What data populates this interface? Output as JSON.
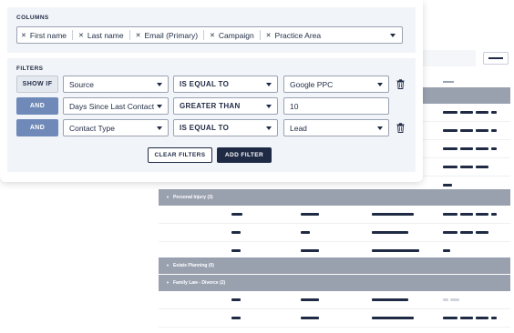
{
  "columns": {
    "title": "COLUMNS",
    "chips": [
      "First name",
      "Last name",
      "Email (Primary)",
      "Campaign",
      "Practice Area"
    ]
  },
  "filters": {
    "title": "FILTERS",
    "rows": [
      {
        "op": "SHOW IF",
        "field": "Source",
        "operator": "IS EQUAL TO",
        "value": "Google PPC",
        "value_type": "select"
      },
      {
        "op": "AND",
        "field": "Days Since Last Contact",
        "operator": "GREATER THAN",
        "value": "10",
        "value_type": "text"
      },
      {
        "op": "AND",
        "field": "Contact Type",
        "operator": "IS EQUAL TO",
        "value": "Lead",
        "value_type": "select"
      }
    ],
    "clear_label": "CLEAR FILTERS",
    "add_label": "ADD FILTER"
  },
  "table": {
    "groups": [
      "Personal Injury (3)",
      "Estate Planning (0)",
      "Family Law - Divorce (2)"
    ]
  },
  "icons": {
    "remove": "close-icon",
    "dropdown": "chevron-down-icon",
    "delete": "trash-icon",
    "view": "list-view-icon"
  },
  "colors": {
    "navy": "#1f2a44",
    "and_button": "#6f89b8",
    "section_bg": "#f1f4f8",
    "group_header": "#99a1af"
  }
}
